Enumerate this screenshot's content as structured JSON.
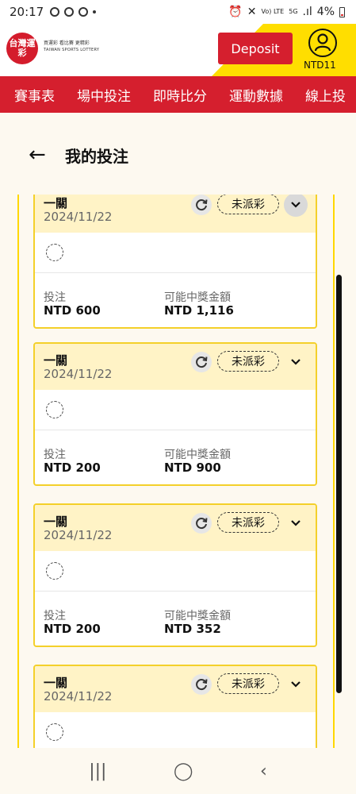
{
  "status_bar": {
    "time": "20:17",
    "battery": "4%",
    "net_volte": "Vo) LTE",
    "net_5g": "5G"
  },
  "header": {
    "logo_text": "台灣運彩",
    "tagline": "買運彩 看比賽 更精彩",
    "tagline_en": "TAIWAN SPORTS LOTTERY",
    "deposit_label": "Deposit",
    "balance": "NTD11"
  },
  "nav": {
    "items": [
      "賽事表",
      "場中投注",
      "即時比分",
      "運動數據",
      "線上投"
    ]
  },
  "page": {
    "back_icon": "←",
    "title": "我的投注"
  },
  "colors": {
    "brand_red": "#d51f2e",
    "brand_yellow": "#ffde00",
    "card_border": "#f4d02a",
    "card_head": "#fff3c6"
  },
  "bets": [
    {
      "type": "一關",
      "date": "2024/11/22",
      "status": "未派彩",
      "stake_label": "投注",
      "stake": "NTD 600",
      "payout_label": "可能中獎金額",
      "payout": "NTD 1,116"
    },
    {
      "type": "一關",
      "date": "2024/11/22",
      "status": "未派彩",
      "stake_label": "投注",
      "stake": "NTD 200",
      "payout_label": "可能中獎金額",
      "payout": "NTD 900"
    },
    {
      "type": "一關",
      "date": "2024/11/22",
      "status": "未派彩",
      "stake_label": "投注",
      "stake": "NTD 200",
      "payout_label": "可能中獎金額",
      "payout": "NTD 352"
    },
    {
      "type": "一關",
      "date": "2024/11/22",
      "status": "未派彩"
    }
  ],
  "system_nav": {
    "recents": "|||",
    "home": "◯",
    "back": "‹"
  }
}
